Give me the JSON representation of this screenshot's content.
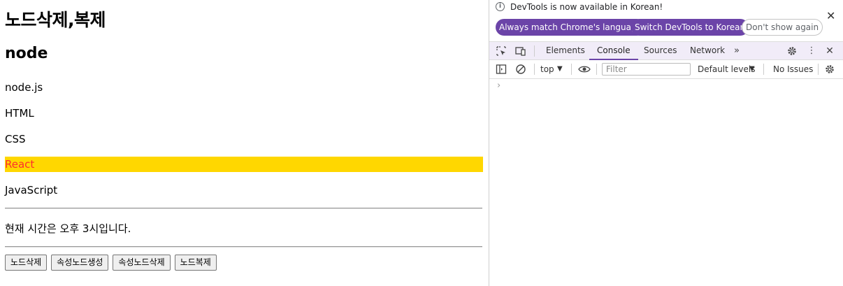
{
  "page": {
    "heading": "노드삭제,복제",
    "subheading": "node",
    "items": [
      "node.js",
      "HTML",
      "CSS",
      "React",
      "JavaScript"
    ],
    "time_text": "현재 시간은 오후 3시입니다.",
    "buttons": [
      "노드삭제",
      "속성노드생성",
      "속성노드삭제",
      "노드복제"
    ],
    "highlight_color": "#ffd700",
    "highlight_text_color": "#ff2d2d"
  },
  "devtools": {
    "info_text": "DevTools is now available in Korean!",
    "info_buttons": [
      "Always match Chrome's language",
      "Switch DevTools to Korean",
      "Don't show again"
    ],
    "tabs": [
      "Elements",
      "Console",
      "Sources",
      "Network"
    ],
    "active_tab": "Console",
    "context": "top",
    "filter_placeholder": "Filter",
    "levels": "Default levels",
    "issues": "No Issues",
    "accent_color": "#6b44a8"
  }
}
